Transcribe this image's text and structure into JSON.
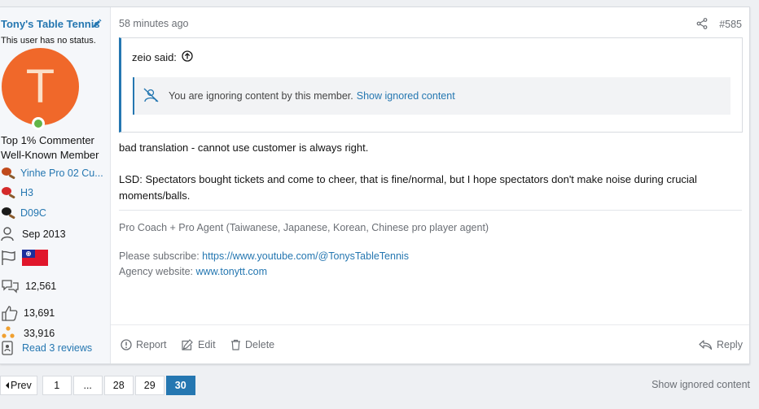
{
  "user": {
    "name": "Tony's Table Tennis",
    "status": "This user has no status.",
    "avatar_letter": "T",
    "banners": [
      "Top 1% Commenter",
      "Well-Known Member"
    ],
    "equipment": [
      {
        "label": "Yinhe Pro 02 Cu...",
        "icon": "paddle-icon",
        "color": "#c04a1c"
      },
      {
        "label": "H3",
        "icon": "paddle-icon",
        "color": "#d42a2a"
      },
      {
        "label": "D09C",
        "icon": "paddle-icon",
        "color": "#1a1a1a"
      }
    ],
    "joined": "Sep 2013",
    "country_flag": "taiwan-flag-icon",
    "messages": "12,561",
    "reaction_score": "13,691",
    "points": "33,916",
    "reviews_link": "Read 3 reviews"
  },
  "post": {
    "timestamp": "58 minutes ago",
    "number": "#585",
    "quote": {
      "author_said": "zeio said:",
      "ignored_text": "You are ignoring content by this member.",
      "show_ignored_link": "Show ignored content"
    },
    "body": [
      "bad translation - cannot use customer is always right.",
      "LSD: Spectators bought tickets and come to cheer, that is fine/normal, but I hope spectators don't make noise during crucial moments/balls."
    ],
    "signature": {
      "line1": "Pro Coach + Pro Agent (Taiwanese, Japanese, Korean, Chinese pro player agent)",
      "subscribe_label": "Please subscribe:",
      "subscribe_link": "https://www.youtube.com/@TonysTableTennis",
      "agency_label": "Agency website:",
      "agency_link": "www.tonytt.com"
    }
  },
  "actions": {
    "report": "Report",
    "edit": "Edit",
    "delete": "Delete",
    "reply": "Reply"
  },
  "pagination": {
    "prev": "Prev",
    "pages": [
      "1",
      "...",
      "28",
      "29",
      "30"
    ],
    "current": "30"
  },
  "footer": {
    "show_ignored": "Show ignored content"
  },
  "colors": {
    "link": "#2577b1",
    "avatar": "#f0682a",
    "online": "#63b649"
  }
}
